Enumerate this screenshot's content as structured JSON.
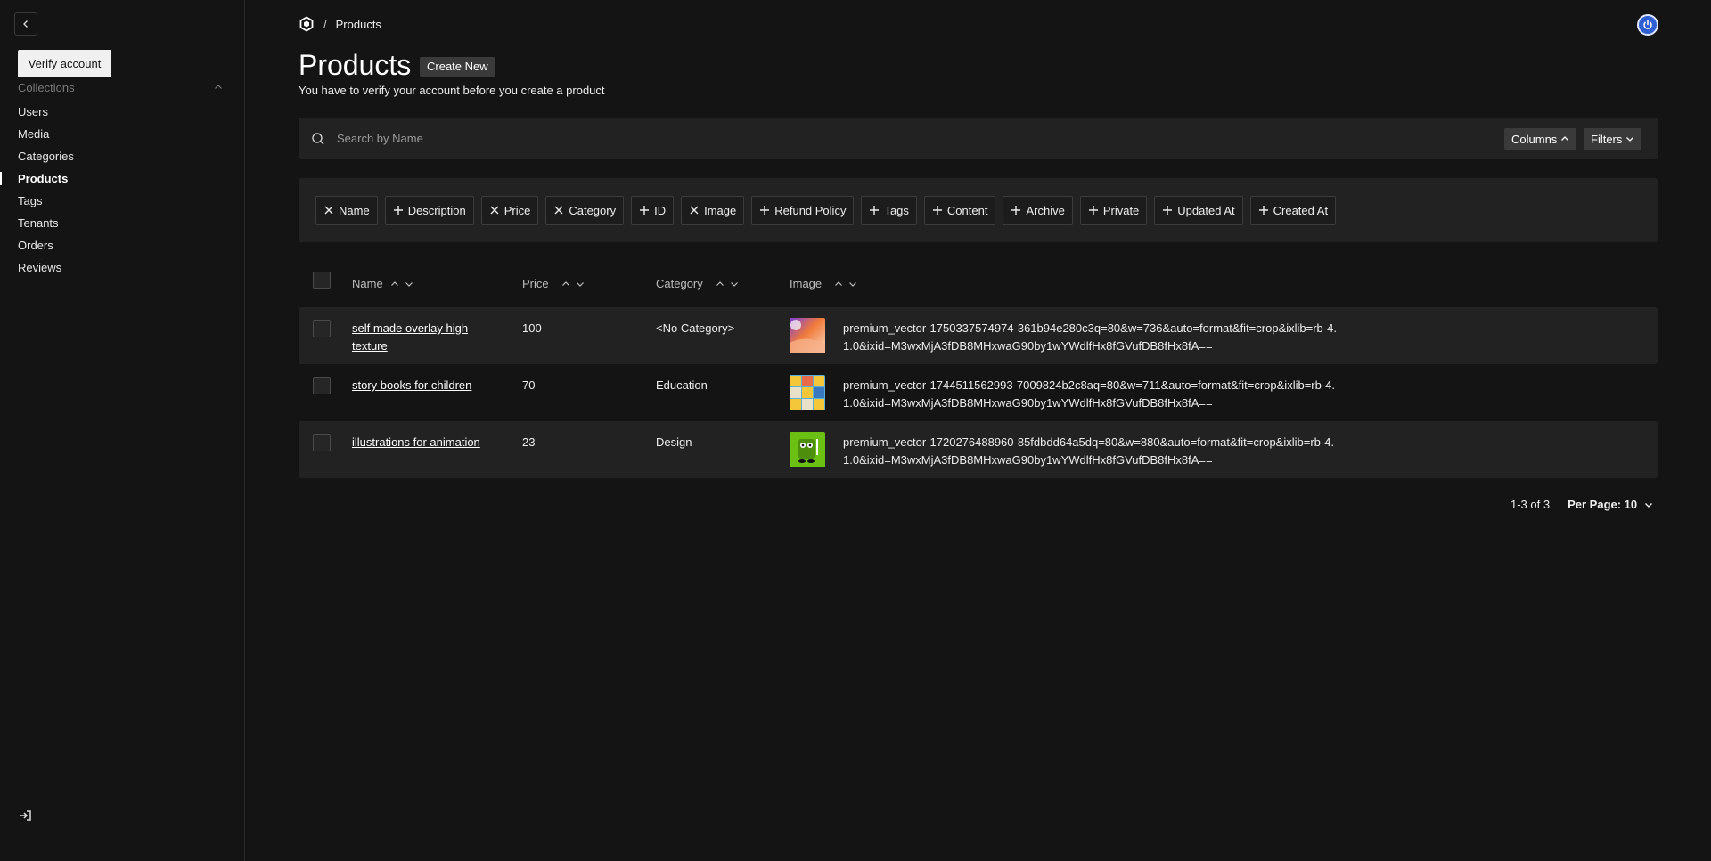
{
  "sidebar": {
    "verify_label": "Verify account",
    "collections_label": "Collections",
    "items": [
      {
        "label": "Users",
        "active": false
      },
      {
        "label": "Media",
        "active": false
      },
      {
        "label": "Categories",
        "active": false
      },
      {
        "label": "Products",
        "active": true
      },
      {
        "label": "Tags",
        "active": false
      },
      {
        "label": "Tenants",
        "active": false
      },
      {
        "label": "Orders",
        "active": false
      },
      {
        "label": "Reviews",
        "active": false
      }
    ]
  },
  "breadcrumb": {
    "separator": "/",
    "current": "Products"
  },
  "page": {
    "title": "Products",
    "create_label": "Create New",
    "notice": "You have to verify your account before you create a product"
  },
  "search": {
    "placeholder": "Search by Name"
  },
  "toolbar": {
    "columns_label": "Columns",
    "filters_label": "Filters"
  },
  "columns": [
    {
      "label": "Name",
      "active": true
    },
    {
      "label": "Description",
      "active": false
    },
    {
      "label": "Price",
      "active": true
    },
    {
      "label": "Category",
      "active": true
    },
    {
      "label": "ID",
      "active": false
    },
    {
      "label": "Image",
      "active": true
    },
    {
      "label": "Refund Policy",
      "active": false
    },
    {
      "label": "Tags",
      "active": false
    },
    {
      "label": "Content",
      "active": false
    },
    {
      "label": "Archive",
      "active": false
    },
    {
      "label": "Private",
      "active": false
    },
    {
      "label": "Updated At",
      "active": false
    },
    {
      "label": "Created At",
      "active": false
    }
  ],
  "table": {
    "headers": {
      "name": "Name",
      "price": "Price",
      "category": "Category",
      "image": "Image"
    },
    "rows": [
      {
        "name": "self made overlay high texture",
        "price": "100",
        "category": "<No Category>",
        "image": "premium_vector-1750337574974-361b94e280c3q=80&w=736&auto=format&fit=crop&ixlib=rb-4.1.0&ixid=M3wxMjA3fDB8MHxwaG90by1wYWdlfHx8fGVufDB8fHx8fA=="
      },
      {
        "name": "story books for children",
        "price": "70",
        "category": "Education",
        "image": "premium_vector-1744511562993-7009824b2c8aq=80&w=711&auto=format&fit=crop&ixlib=rb-4.1.0&ixid=M3wxMjA3fDB8MHxwaG90by1wYWdlfHx8fGVufDB8fHx8fA=="
      },
      {
        "name": "illustrations for animation",
        "price": "23",
        "category": "Design",
        "image": "premium_vector-1720276488960-85fdbdd64a5dq=80&w=880&auto=format&fit=crop&ixlib=rb-4.1.0&ixid=M3wxMjA3fDB8MHxwaG90by1wYWdlfHx8fGVufDB8fHx8fA=="
      }
    ]
  },
  "pagination": {
    "range": "1-3 of 3",
    "per_page_label": "Per Page: 10"
  },
  "colors": {
    "background": "#141414",
    "panel": "#222222",
    "avatar": "#2f5fd0"
  }
}
